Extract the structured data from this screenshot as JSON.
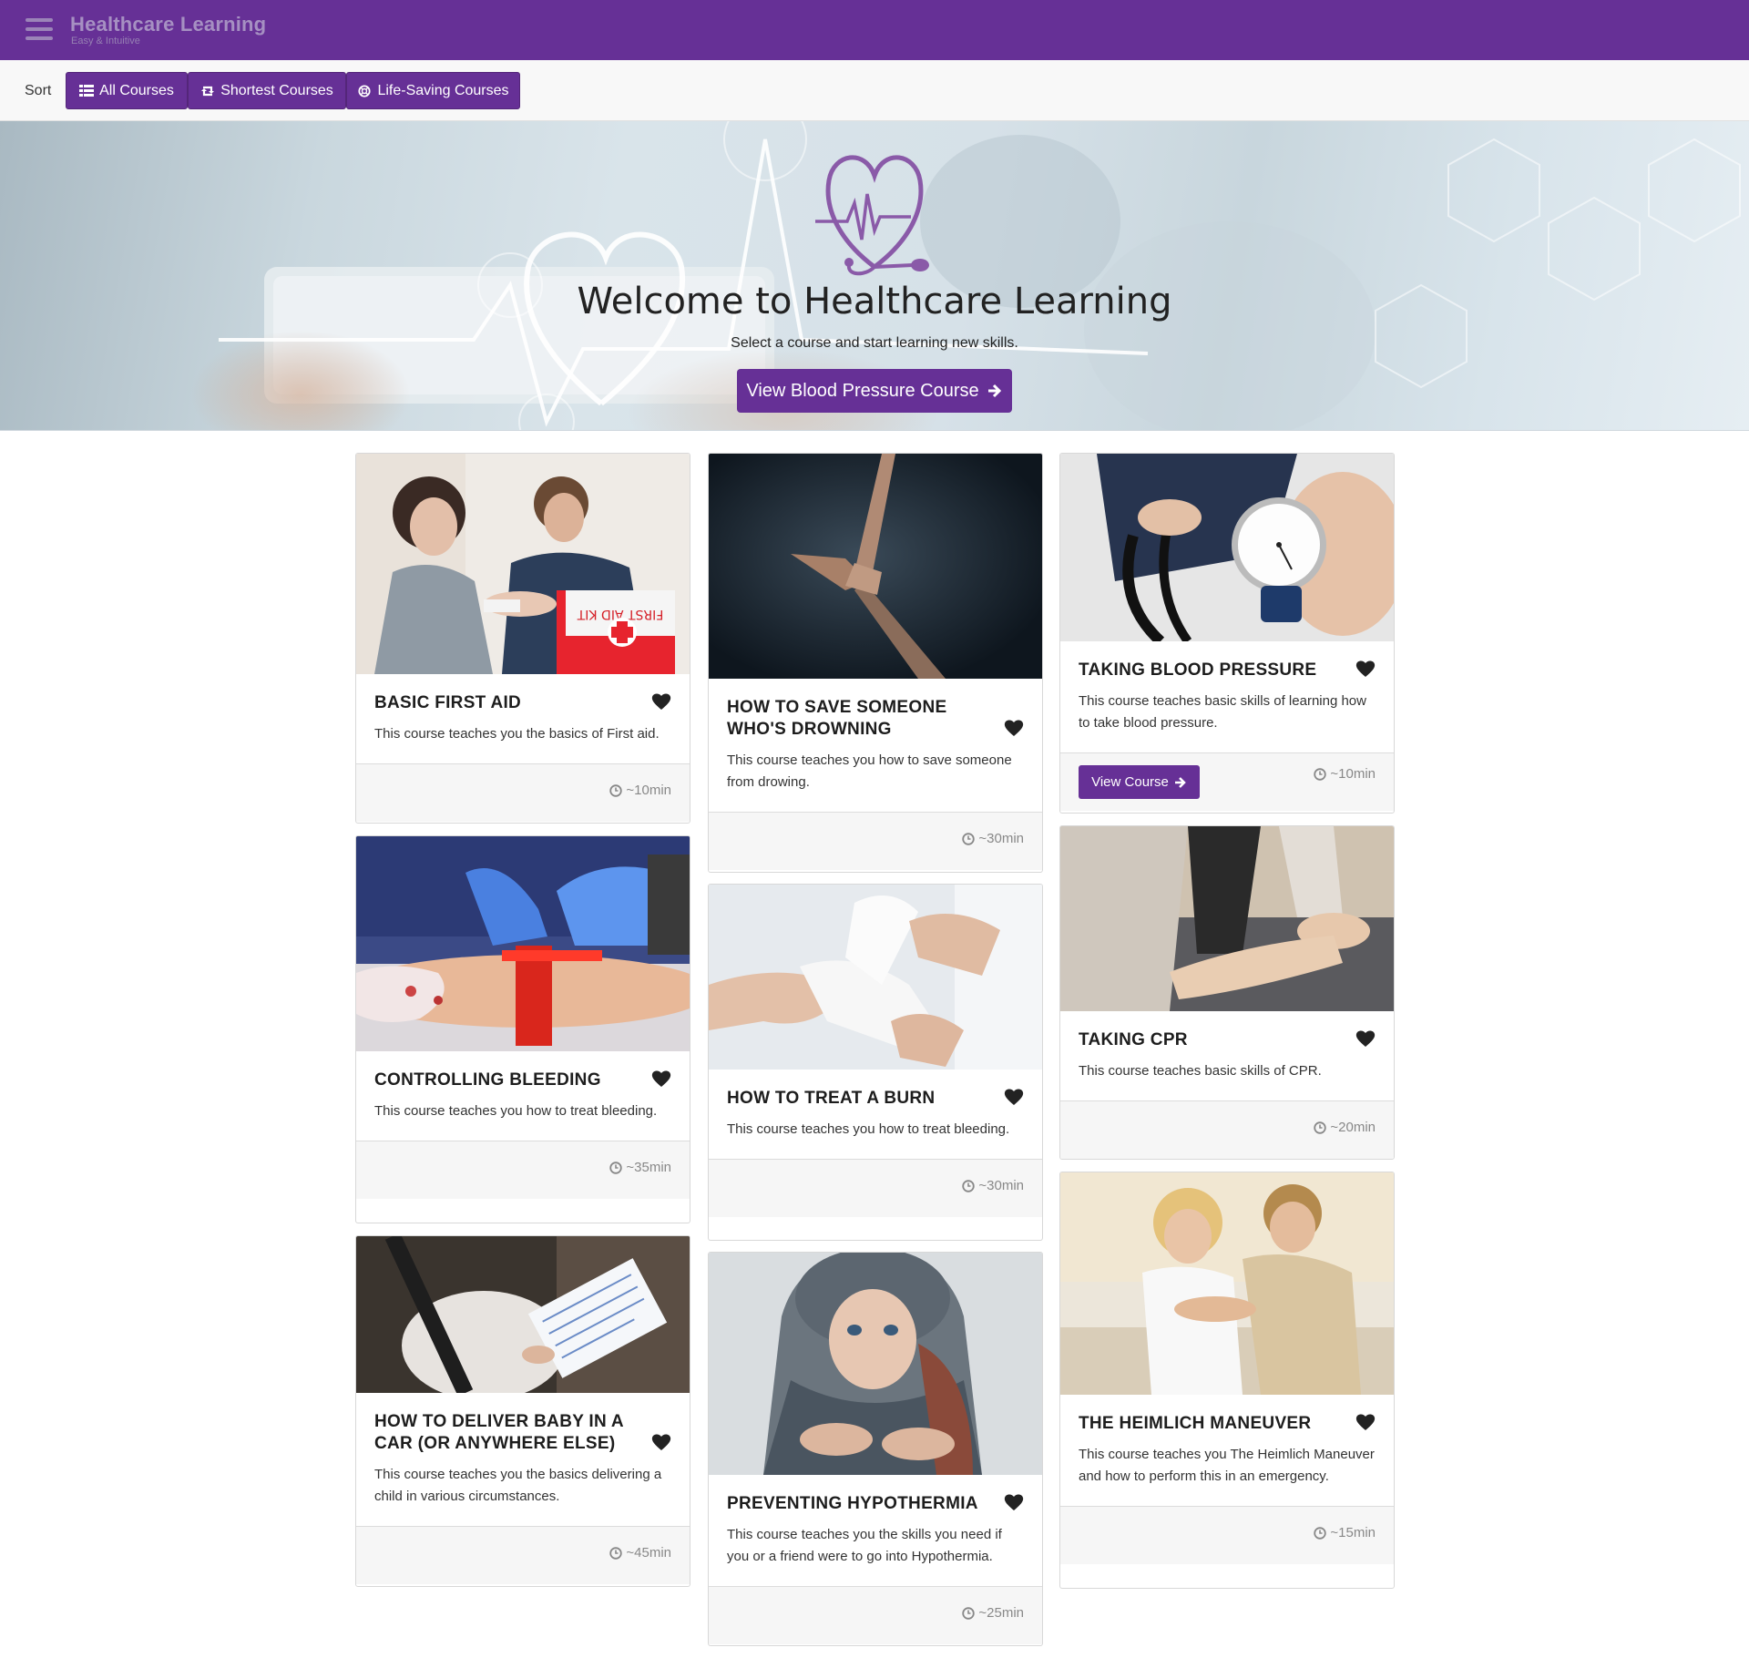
{
  "navbar": {
    "title": "Healthcare Learning",
    "subtitle": "Easy & Intuitive"
  },
  "sort": {
    "label": "Sort",
    "buttons": [
      {
        "label": "All Courses",
        "icon": "list-icon"
      },
      {
        "label": "Shortest Courses",
        "icon": "retweet-icon"
      },
      {
        "label": "Life-Saving Courses",
        "icon": "lifebuoy-icon"
      }
    ]
  },
  "hero": {
    "title": "Welcome to Healthcare Learning",
    "subtitle": "Select a course and start learning new skills.",
    "button_label": "View Blood Pressure Course",
    "logo": "heart-stethoscope-logo"
  },
  "colors": {
    "brand": "#663096",
    "card_footer": "#f6f6f6"
  },
  "courses": [
    {
      "title": "Basic First Aid",
      "description": "This course teaches you the basics of First aid.",
      "duration": "~10min",
      "image": "first-aid-kit-photo"
    },
    {
      "title": "How to Save Someone Who's Drowning",
      "description": "This course teaches you how to save someone from drowing.",
      "duration": "~30min",
      "image": "reaching-hands-photo"
    },
    {
      "title": "Taking Blood Pressure",
      "description": "This course teaches basic skills of learning how to take blood pressure.",
      "duration": "~10min",
      "view_button": "View Course",
      "image": "blood-pressure-gauge-photo"
    },
    {
      "title": "Controlling Bleeding",
      "description": "This course teaches you how to treat bleeding.",
      "duration": "~35min",
      "image": "tourniquet-photo"
    },
    {
      "title": "How to Treat a Burn",
      "description": "This course teaches you how to treat bleeding.",
      "duration": "~30min",
      "image": "bandaging-hand-photo"
    },
    {
      "title": "Taking CPR",
      "description": "This course teaches basic skills of CPR.",
      "duration": "~20min",
      "image": "cpr-training-photo"
    },
    {
      "title": "How to Deliver Baby in a Car (or Anywhere Else)",
      "description": "This course teaches you the basics delivering a child in various circumstances.",
      "duration": "~45min",
      "image": "pregnant-woman-photo"
    },
    {
      "title": "Preventing Hypothermia",
      "description": "This course teaches you the skills you need if you or a friend were to go into Hypothermia.",
      "duration": "~25min",
      "image": "cold-woman-photo"
    },
    {
      "title": "The Heimlich Maneuver",
      "description": "This course teaches you The Heimlich Maneuver and how to perform this in an emergency.",
      "duration": "~15min",
      "image": "heimlich-photo"
    }
  ]
}
